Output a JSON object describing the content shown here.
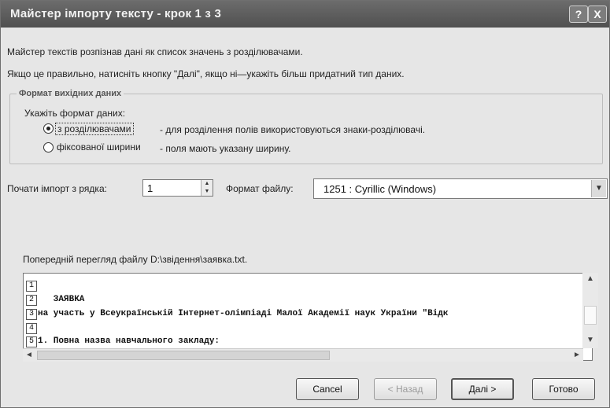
{
  "window": {
    "title": "Майстер імпорту тексту - крок 1 з 3",
    "help_label": "?",
    "close_label": "X"
  },
  "intro": {
    "line1": "Майстер текстів розпізнав дані як список значень з розділювачами.",
    "line2": "Якщо це правильно, натисніть кнопку \"Далі\", якщо ні—укажіть більш придатний тип даних."
  },
  "format_group": {
    "legend": "Формат вихідних даних",
    "prompt": "Укажіть формат даних:",
    "options": [
      {
        "label": "з розділювачами",
        "description": "- для розділення полів використовуються знаки-розділювачі.",
        "selected": true
      },
      {
        "label": "фіксованої ширини",
        "description": "- поля мають указану ширину.",
        "selected": false
      }
    ]
  },
  "start_row": {
    "label": "Почати імпорт з рядка:",
    "value": "1"
  },
  "file_origin": {
    "label": "Формат файлу:",
    "value": "1251 : Cyrillic (Windows)"
  },
  "preview": {
    "label": "Попередній перегляд файлу D:\\звідення\\заявка.txt.",
    "rows": [
      {
        "num": "1",
        "text": ""
      },
      {
        "num": "2",
        "text": "   ЗАЯВКА"
      },
      {
        "num": "3",
        "text": "на участь у Всеукраїнській Інтернет-олімпіаді Малої Академії наук України \"Відк"
      },
      {
        "num": "4",
        "text": ""
      },
      {
        "num": "5",
        "text": "1. Повна назва навчального закладу:"
      }
    ],
    "scroll_up": "▲",
    "scroll_down": "▼",
    "scroll_left": "◄",
    "scroll_right": "►"
  },
  "buttons": {
    "cancel": "Cancel",
    "back": "< Назад",
    "next": "Далі >",
    "finish": "Готово"
  }
}
